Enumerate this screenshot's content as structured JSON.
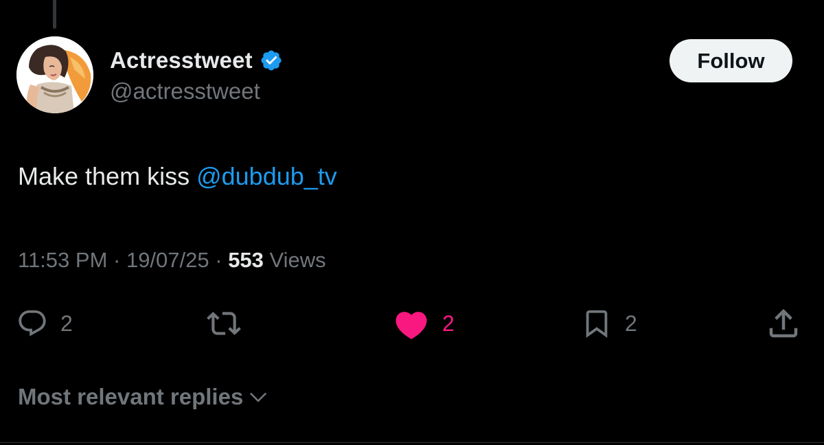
{
  "author": {
    "display_name": "Actresstweet",
    "handle": "@actresstweet",
    "verified": true,
    "avatar_icon": "illustrated-woman-avatar"
  },
  "follow_button": {
    "label": "Follow"
  },
  "tweet": {
    "text": "Make them kiss ",
    "mention": "@dubdub_tv"
  },
  "meta": {
    "time": "11:53 PM",
    "separator": " · ",
    "date": "19/07/25",
    "views_count": "553",
    "views_label": " Views"
  },
  "actions": {
    "reply": {
      "icon": "reply-icon",
      "count": "2"
    },
    "repost": {
      "icon": "repost-icon"
    },
    "like": {
      "icon": "heart-icon",
      "count": "2",
      "liked": true
    },
    "bookmark": {
      "icon": "bookmark-icon",
      "count": "2"
    },
    "share": {
      "icon": "share-icon"
    }
  },
  "replies_sort": {
    "label": "Most relevant replies",
    "icon": "chevron-down-icon"
  },
  "colors": {
    "background": "#000000",
    "primary_text": "#e7e9ea",
    "secondary_text": "#71767b",
    "link": "#1d9bf0",
    "like": "#f91880",
    "verified": "#1d9bf0",
    "follow_bg": "#eff3f4"
  }
}
